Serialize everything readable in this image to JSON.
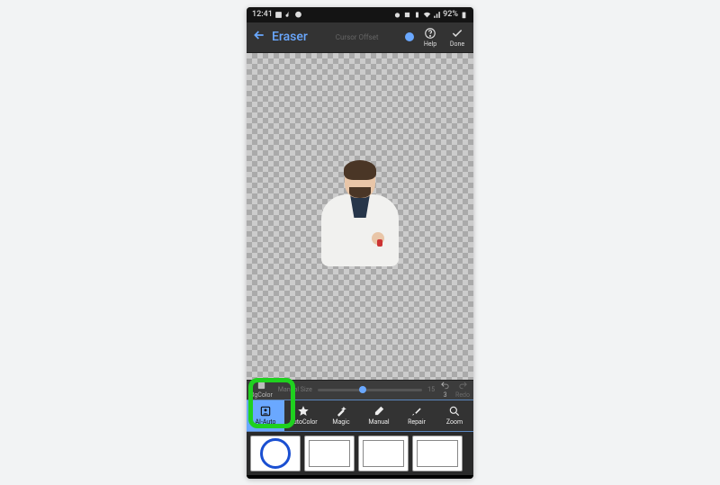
{
  "status_bar": {
    "time": "12:41",
    "battery_text": "92%",
    "icons_left": [
      "image-icon",
      "tiktok-icon",
      "messenger-icon"
    ],
    "icons_right": [
      "alarm-icon",
      "nfc-icon",
      "vibrate-icon",
      "wifi-icon",
      "signal-icon",
      "battery-icon"
    ]
  },
  "header": {
    "title": "Eraser",
    "slider_label": "Cursor Offset",
    "help_label": "Help",
    "done_label": "Done"
  },
  "control_strip": {
    "bgcolor_label": "BgColor",
    "slider_label": "Manual Size",
    "slider_value": "15",
    "undo_count": "3",
    "redo_label": "Redo"
  },
  "tools": {
    "ai_auto": "AI-Auto",
    "auto_color": "AutoColor",
    "magic": "Magic",
    "manual": "Manual",
    "repair": "Repair",
    "zoom": "Zoom",
    "active": "ai_auto"
  },
  "thumbnails": {
    "count": 4
  }
}
